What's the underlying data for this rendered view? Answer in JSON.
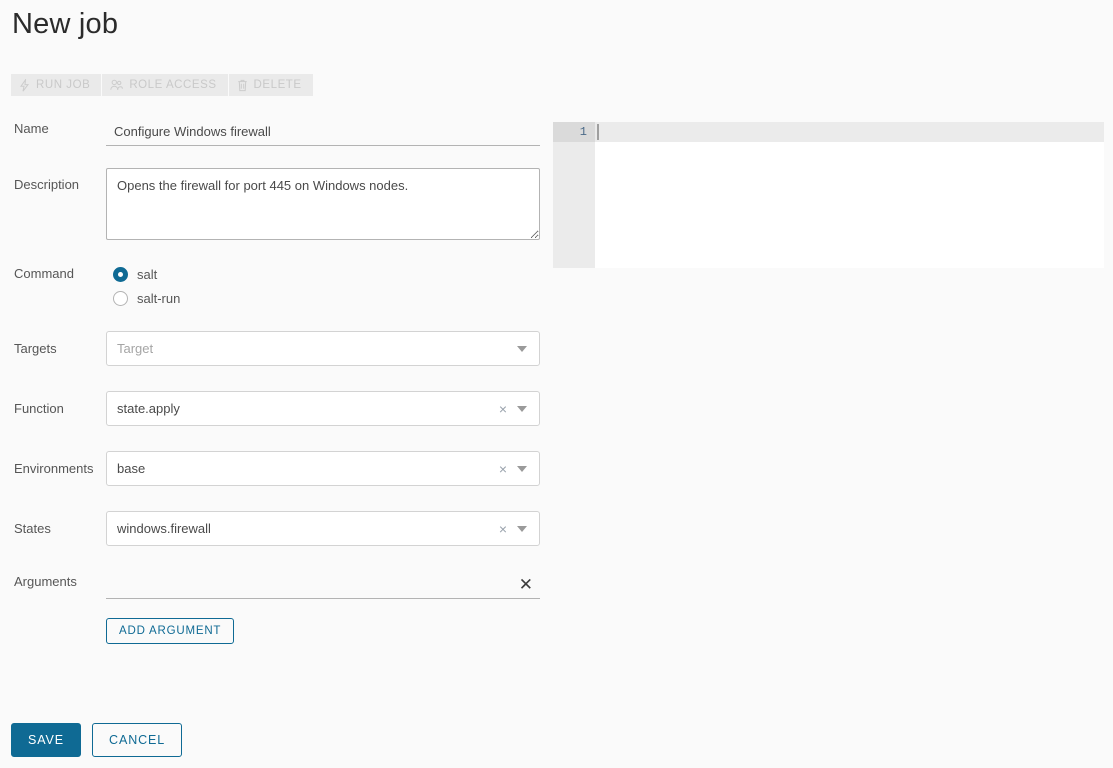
{
  "header": {
    "title": "New job"
  },
  "toolbar": {
    "buttons": [
      {
        "label": "RUN JOB",
        "icon": "lightning-bolt-icon",
        "disabled": true
      },
      {
        "label": "ROLE ACCESS",
        "icon": "users-group-icon",
        "disabled": true
      },
      {
        "label": "DELETE",
        "icon": "trash-icon",
        "disabled": true
      }
    ]
  },
  "form": {
    "name": {
      "label": "Name",
      "value": "Configure Windows firewall",
      "placeholder": ""
    },
    "description": {
      "label": "Description",
      "value": "Opens the firewall for port 445 on Windows nodes.",
      "placeholder": ""
    },
    "command": {
      "label": "Command",
      "selected": "salt",
      "options": [
        {
          "label": "salt",
          "checked": true
        },
        {
          "label": "salt-run",
          "checked": false
        }
      ]
    },
    "targets": {
      "label": "Targets",
      "value": "",
      "placeholder": "Target"
    },
    "function": {
      "label": "Function",
      "value": "state.apply",
      "clear": "×"
    },
    "environments": {
      "label": "Environments",
      "value": "base",
      "clear": "×"
    },
    "states": {
      "label": "States",
      "value": "windows.firewall",
      "clear": "×"
    },
    "arguments": {
      "label": "Arguments",
      "value": "",
      "remove": "✕",
      "add_label": "ADD ARGUMENT"
    }
  },
  "editor": {
    "line_numbers": [
      "1"
    ],
    "content": ""
  },
  "footer": {
    "save_label": "SAVE",
    "cancel_label": "CANCEL"
  },
  "colors": {
    "accent": "#0f6a94",
    "page_background": "#fafafa",
    "disabled_text": "#c9c9c9"
  }
}
